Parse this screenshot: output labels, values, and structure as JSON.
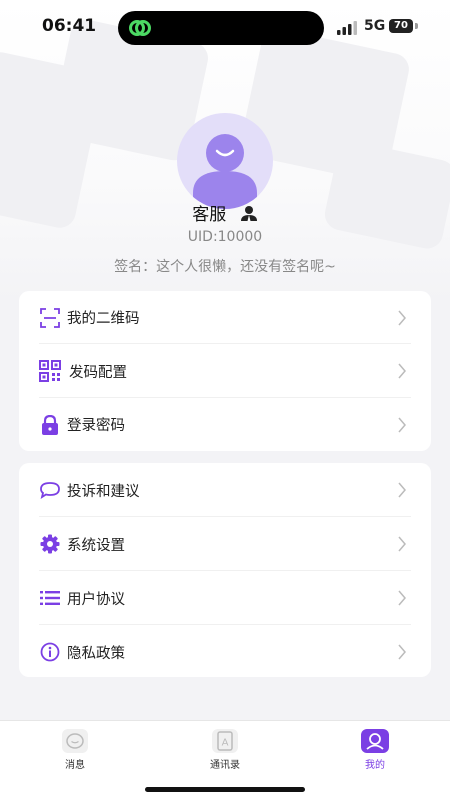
{
  "status_bar": {
    "time": "06:41",
    "network": "5G",
    "battery": "70"
  },
  "profile": {
    "name": "客服",
    "uid": "UID:10000",
    "signature": "签名：这个人很懒，还没有签名呢~"
  },
  "menu_group_1": [
    {
      "label": "我的二维码",
      "icon": "scan-frame-icon"
    },
    {
      "label": "发码配置",
      "icon": "qr-code-icon"
    },
    {
      "label": "登录密码",
      "icon": "lock-icon"
    }
  ],
  "menu_group_2": [
    {
      "label": "投诉和建议",
      "icon": "chat-bubble-icon"
    },
    {
      "label": "系统设置",
      "icon": "gear-icon"
    },
    {
      "label": "用户协议",
      "icon": "list-icon"
    },
    {
      "label": "隐私政策",
      "icon": "info-icon"
    }
  ],
  "tabbar": [
    {
      "label": "消息",
      "icon": "message-icon",
      "active": false
    },
    {
      "label": "通讯录",
      "icon": "contacts-icon",
      "active": false
    },
    {
      "label": "我的",
      "icon": "profile-icon",
      "active": true
    }
  ],
  "colors": {
    "accent": "#7b3fe4",
    "avatar_bg": "#e3def9",
    "avatar_fg": "#9c84ec",
    "island_icon": "#4cd964"
  }
}
